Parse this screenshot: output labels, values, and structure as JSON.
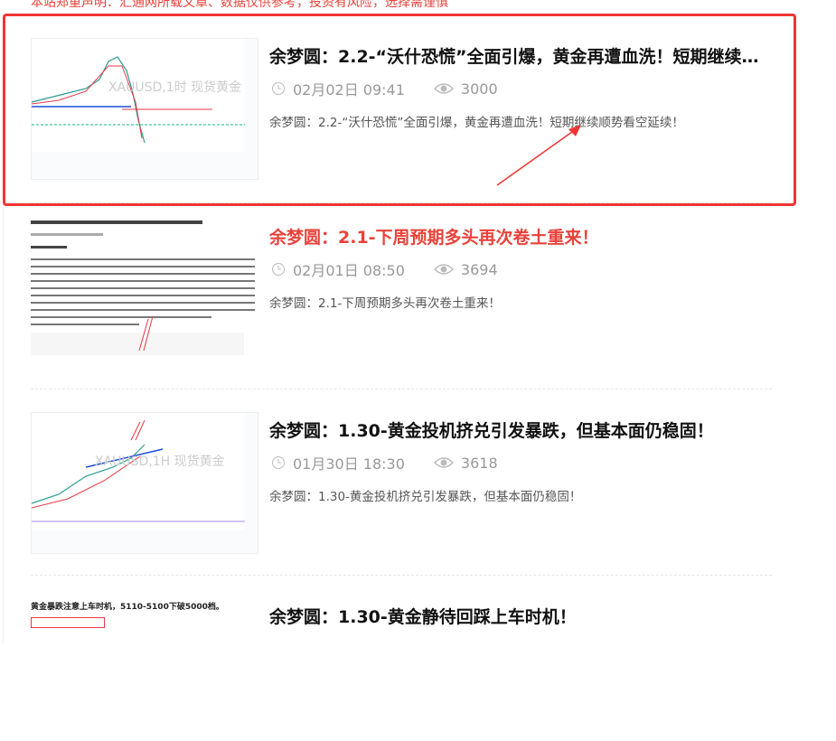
{
  "notice": "本站郑重声明：汇通网所载文章、数据仅供参考，投资有风险，选择需谨慎",
  "articles": [
    {
      "title": "余梦圆：2.2-“沃什恐慌”全面引爆，黄金再遭血洗！短期继续顺势看空延续！",
      "date": "02月02日 09:41",
      "views": "3000",
      "desc": "余梦圆：2.2-“沃什恐慌”全面引爆，黄金再遭血洗！短期继续顺势看空延续！",
      "thumb_label": "XAUUSD,1时 现货黄金"
    },
    {
      "title": "余梦圆：2.1-下周预期多头再次卷土重来！",
      "date": "02月01日 08:50",
      "views": "3694",
      "desc": "余梦圆：2.1-下周预期多头再次卷土重来！"
    },
    {
      "title": "余梦圆：1.30-黄金投机挤兑引发暴跌，但基本面仍稳固！",
      "date": "01月30日 18:30",
      "views": "3618",
      "desc": "余梦圆：1.30-黄金投机挤兑引发暴跌，但基本面仍稳固！",
      "thumb_label": "XAUUSD,1H 现货黄金"
    },
    {
      "title": "余梦圆：1.30-黄金静待回踩上车时机！",
      "thumb_label": "黄金暴跌注意上车时机，5110-5100下破5000档。"
    }
  ],
  "colors": {
    "accent": "#e8423a"
  }
}
